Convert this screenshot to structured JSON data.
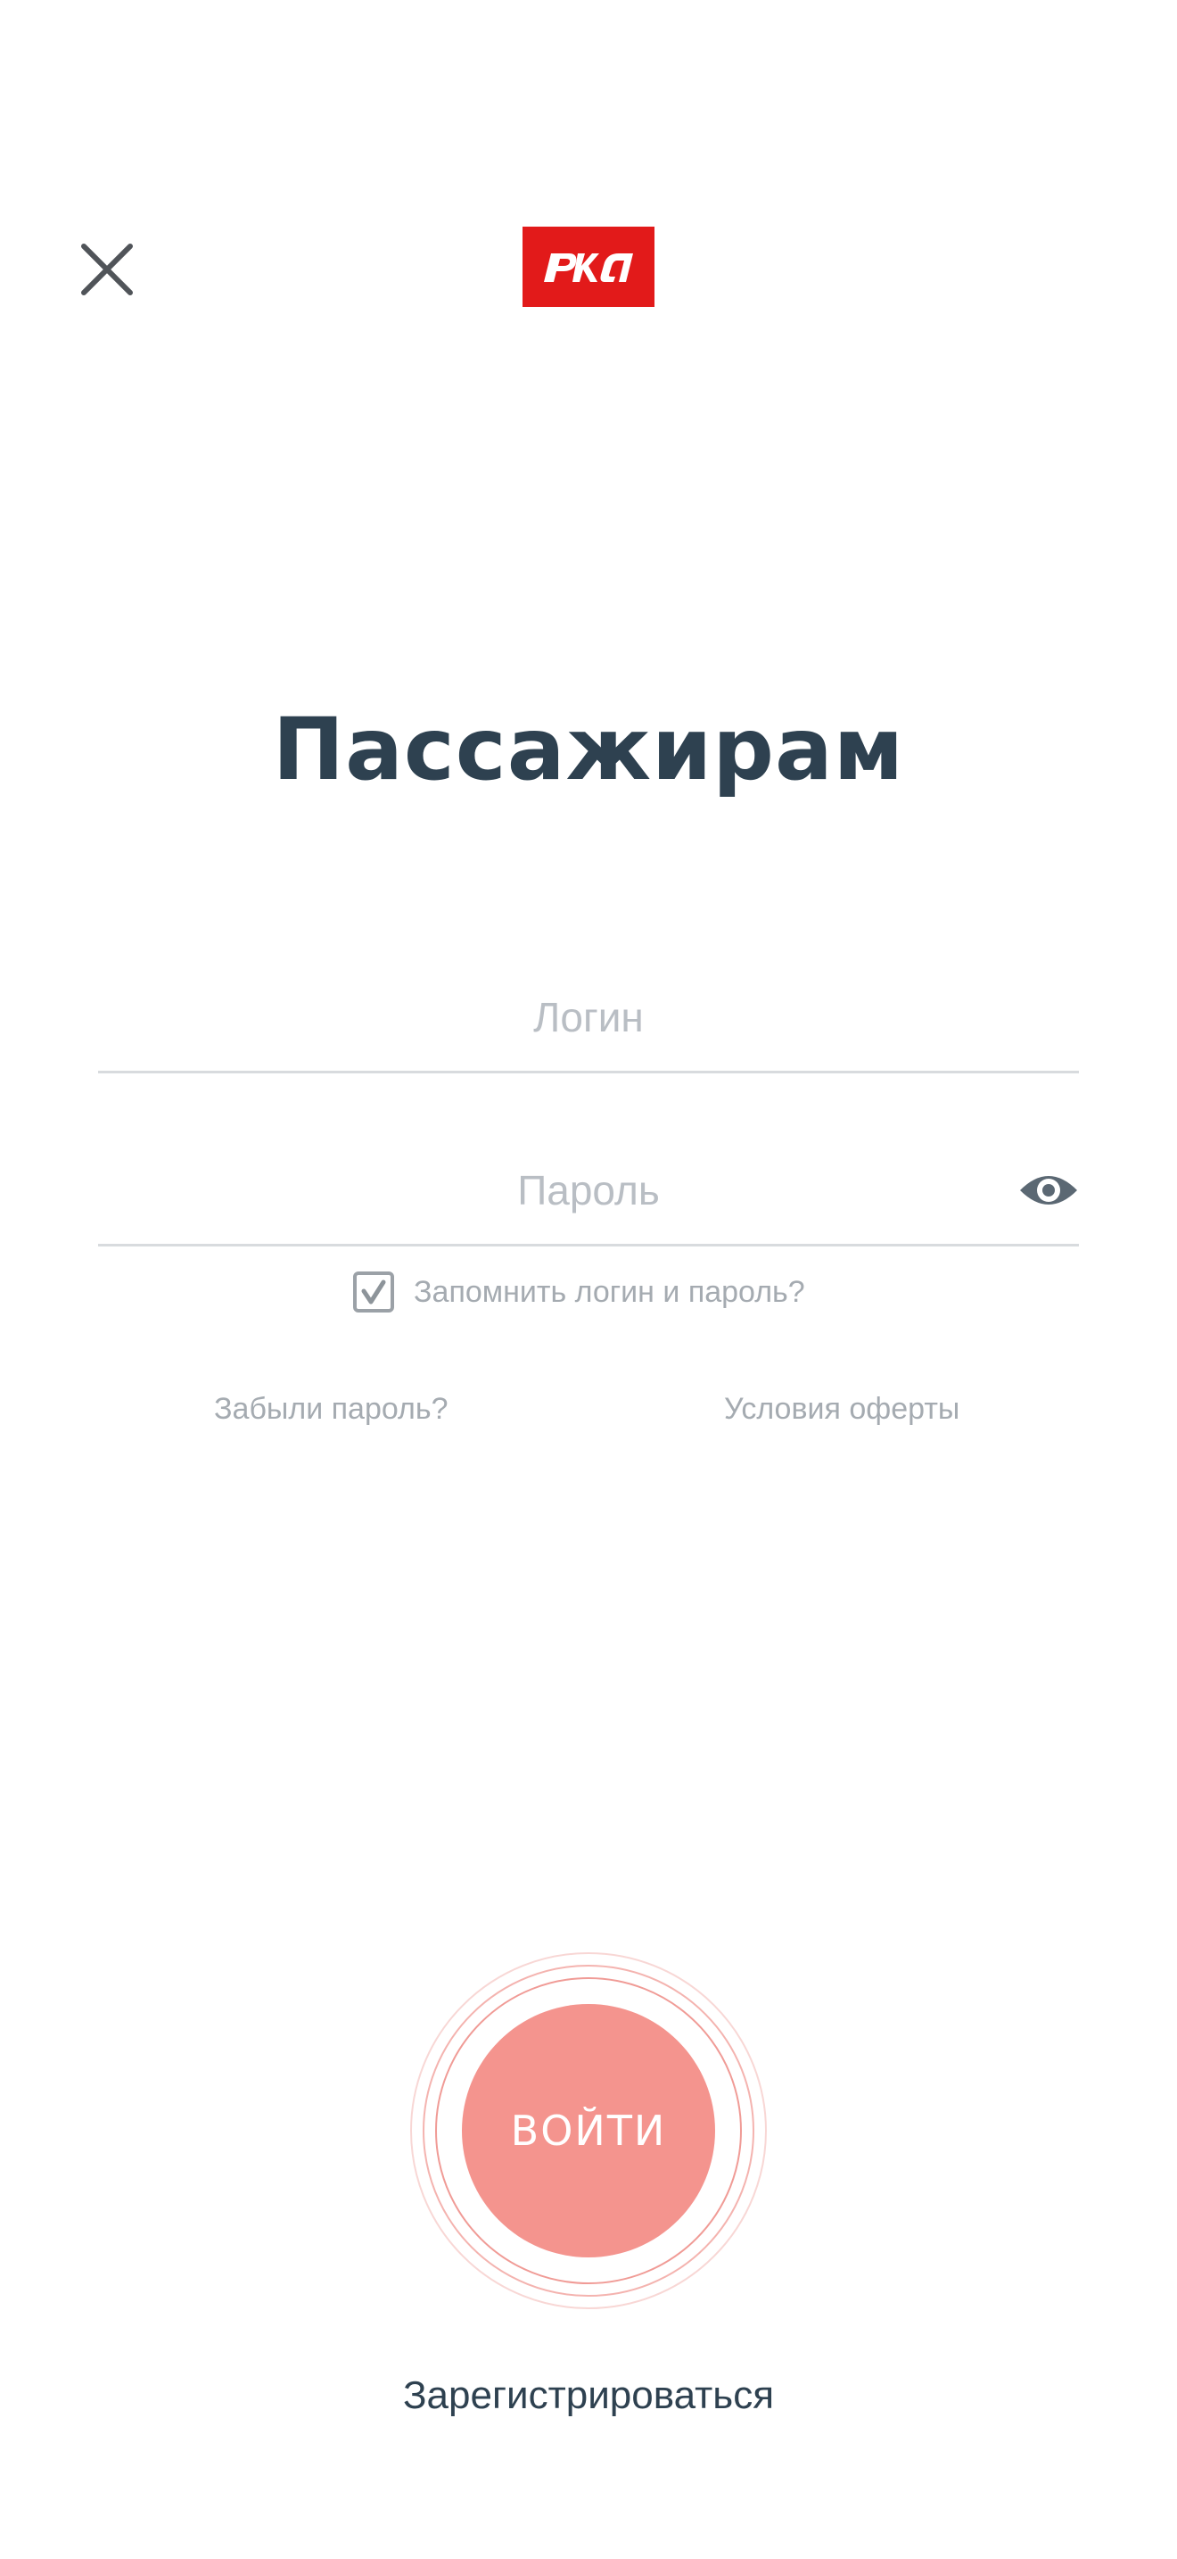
{
  "header": {
    "logo_text": "РЖД",
    "close_icon": "close-icon"
  },
  "page": {
    "title": "Пассажирам"
  },
  "form": {
    "login": {
      "placeholder": "Логин",
      "value": ""
    },
    "password": {
      "placeholder": "Пароль",
      "value": "",
      "toggle_icon": "eye-icon"
    },
    "remember": {
      "label": "Запомнить логин и пароль?",
      "checked": true
    }
  },
  "links": {
    "forgot_password": "Забыли пароль?",
    "offer_terms": "Условия оферты"
  },
  "actions": {
    "login_label": "ВОЙТИ",
    "register_label": "Зарегистрироваться"
  },
  "colors": {
    "brand_red": "#e21a1a",
    "title": "#2e4150",
    "button": "#f4948e",
    "muted": "#a5abb1"
  }
}
